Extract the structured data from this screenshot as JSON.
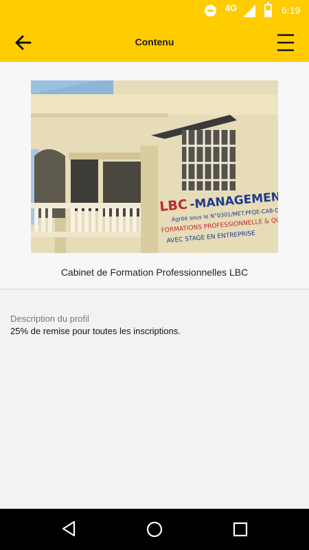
{
  "status_bar": {
    "network": "4G",
    "time": "6:19",
    "icons": [
      "do-not-disturb-icon",
      "signal-icon",
      "battery-icon"
    ]
  },
  "app_bar": {
    "title": "Contenu",
    "back_icon": "arrow-left-icon",
    "menu_icon": "hamburger-menu-icon"
  },
  "profile": {
    "image_sign_text": "LBC-MANAGEMENT",
    "caption": "Cabinet de Formation Professionnelles LBC"
  },
  "description": {
    "label": "Description du profil",
    "text": "25% de remise pour toutes les inscriptions."
  },
  "nav_bar": {
    "icons": [
      "nav-back-icon",
      "nav-home-icon",
      "nav-recent-apps-icon"
    ]
  },
  "colors": {
    "accent": "#ffcc00",
    "background": "#f2f2f2",
    "navbar": "#000000"
  }
}
